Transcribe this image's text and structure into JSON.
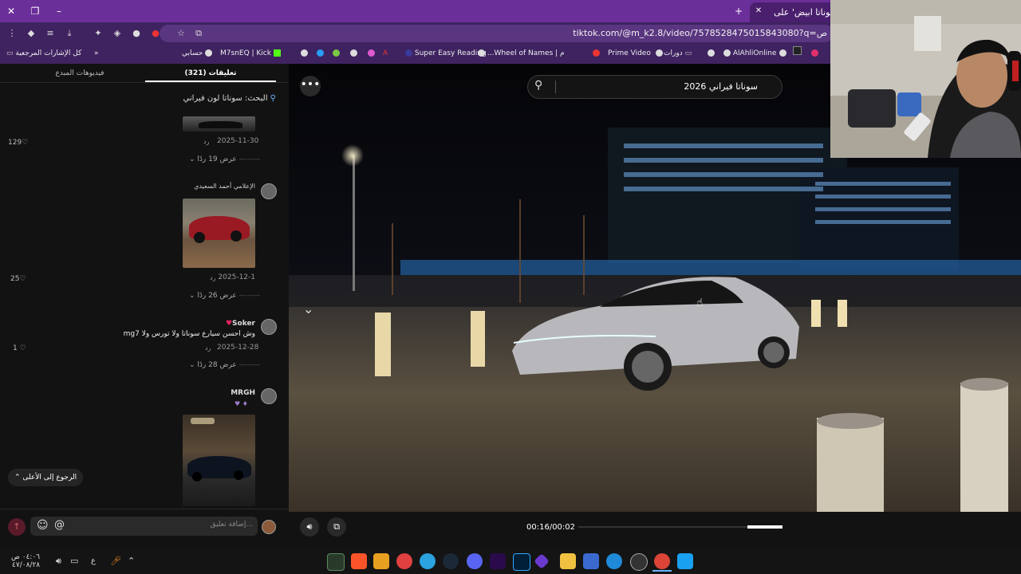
{
  "browser": {
    "tab_title": "سوناتا ابيض' على",
    "url": "tiktok.com/@m_k2.8/video/7578528475015843080?q=ص",
    "new_tab": "+"
  },
  "bookmarks": {
    "all_bookmarks": "كل الإشارات المرجعية",
    "items": [
      "حسابي",
      "M7snEQ | Kick",
      "Super Easy Reading",
      "...Wheel of Names | م",
      "Prime Video",
      "دورات",
      "AlAhliOnline"
    ]
  },
  "comments_panel": {
    "tab_comments": "تعليقات (321)",
    "tab_creator_videos": "فيديوهات المبدع",
    "search_label": "البحث: سوناتا لون فيراني",
    "comments": [
      {
        "date": "2025-11-30",
        "reply": "رد",
        "likes": "129",
        "view_replies": "عرض 19 ردًا"
      },
      {
        "author": "الإعلامي أحمد السعيدي",
        "date": "2025-12-1",
        "reply": "رد",
        "likes": "25",
        "view_replies": "عرض 26 ردًا"
      },
      {
        "author": "Soker",
        "text": "وش احسن سيارع سوناتا ولا تورس ولا mg7",
        "date": "2025-12-28",
        "reply": "رد",
        "likes": "1",
        "view_replies": "عرض 28 ردًا"
      },
      {
        "author": "MRGH"
      }
    ],
    "back_to_top": "الرجوع إلى الأعلى",
    "input_placeholder": "إضافة تعليق..."
  },
  "video": {
    "search_value": "سوناتا فيراني 2026",
    "time": "00:16/00:02",
    "progress": 0.83
  },
  "taskbar": {
    "time": "٠٤:٠٦ ص",
    "date": "٤٧/٠٨/٢٨",
    "lang": "ع"
  },
  "colors": {
    "titlebar": "#6b2f9a",
    "toolbar": "#3e2360",
    "accent_red": "#e0245e"
  }
}
